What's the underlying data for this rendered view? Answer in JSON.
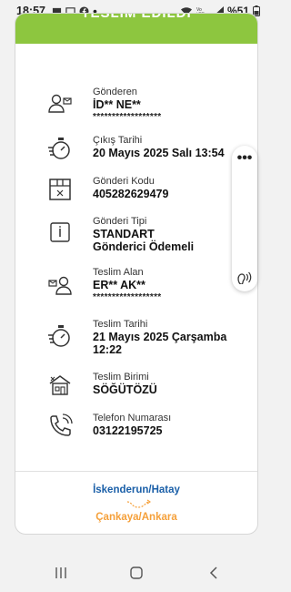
{
  "status": {
    "time": "18:57",
    "battery": "%51",
    "notif_icons": [
      "message-icon",
      "message-icon",
      "facebook-icon",
      "dot-icon"
    ],
    "right_icons": [
      "wifi-icon",
      "volte-icon",
      "signal-icon"
    ]
  },
  "banner": {
    "title": "TESLİM EDİLDİ",
    "color": "#8dc63f"
  },
  "details": {
    "sender": {
      "label": "Gönderen",
      "value": "İD** NE**",
      "masked": "******************"
    },
    "departure": {
      "label": "Çıkış Tarihi",
      "value": "20 Mayıs 2025 Salı 13:54"
    },
    "code": {
      "label": "Gönderi Kodu",
      "value": "405282629479"
    },
    "type": {
      "label": "Gönderi Tipi",
      "value1": "STANDART",
      "value2": "Gönderici Ödemeli"
    },
    "receiver": {
      "label": "Teslim Alan",
      "value": "ER** AK**",
      "masked": "******************"
    },
    "delivery_date": {
      "label": "Teslim Tarihi",
      "value1": "21 Mayıs 2025 Çarşamba",
      "value2": "12:22"
    },
    "unit": {
      "label": "Teslim Birimi",
      "value": "SÖĞÜTÖZÜ"
    },
    "phone": {
      "label": "Telefon Numarası",
      "value": "03122195725"
    }
  },
  "route": {
    "from": "İskenderun/Hatay",
    "to": "Çankaya/Ankara",
    "from_color": "#1a5fa8",
    "to_color": "#f5a03a"
  },
  "floating": {
    "menu": "•••"
  }
}
